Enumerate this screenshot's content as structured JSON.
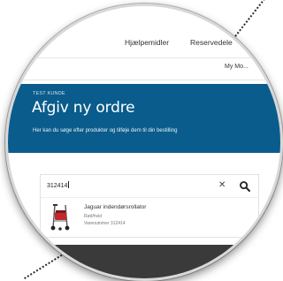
{
  "nav": {
    "items": [
      "Hjælpemidler",
      "Reservedele"
    ],
    "sub_item": "My Mo..."
  },
  "hero": {
    "kicker": "TEST KUNDE",
    "title": "Afgiv ny ordre",
    "description": "Her kan du søge efter produkter og tilføje dem til din bestilling"
  },
  "search": {
    "value": "312414",
    "clear_icon": "close-icon",
    "search_icon": "search-icon"
  },
  "results": [
    {
      "name": "Jaguar indendørsrollator",
      "variant": "Rød/hvid",
      "sku": "Varenummer 312414"
    }
  ],
  "colors": {
    "hero_bg": "#0a5c8c",
    "footer_bg": "#3a3a3a"
  }
}
